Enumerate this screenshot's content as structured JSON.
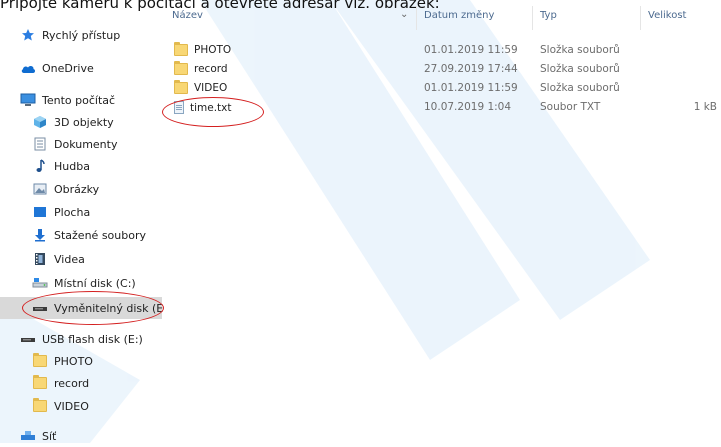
{
  "caption": "Připojte kameru k počítači a otevřete adresář viz. obrázek:",
  "nav": {
    "items": [
      {
        "label": "Rychlý přístup",
        "icon": "star-icon"
      },
      {
        "label": "OneDrive",
        "icon": "cloud-icon"
      },
      {
        "label": "Tento počítač",
        "icon": "computer-icon"
      },
      {
        "label": "3D objekty",
        "icon": "cube-icon"
      },
      {
        "label": "Dokumenty",
        "icon": "document-icon"
      },
      {
        "label": "Hudba",
        "icon": "music-note-icon"
      },
      {
        "label": "Obrázky",
        "icon": "pictures-icon"
      },
      {
        "label": "Plocha",
        "icon": "desktop-icon"
      },
      {
        "label": "Stažené soubory",
        "icon": "download-arrow-icon"
      },
      {
        "label": "Videa",
        "icon": "film-icon"
      },
      {
        "label": "Místní disk (C:)",
        "icon": "local-disk-icon"
      },
      {
        "label": "Vyměnitelný disk (E",
        "icon": "removable-drive-icon"
      },
      {
        "label": "USB flash disk (E:)",
        "icon": "usb-drive-icon"
      },
      {
        "label": "PHOTO",
        "icon": "folder-icon"
      },
      {
        "label": "record",
        "icon": "folder-icon"
      },
      {
        "label": "VIDEO",
        "icon": "folder-icon"
      },
      {
        "label": "Síť",
        "icon": "network-icon"
      }
    ]
  },
  "columns": {
    "name": "Název",
    "date": "Datum změny",
    "type": "Typ",
    "size": "Velikost"
  },
  "files": [
    {
      "name": "PHOTO",
      "date": "01.01.2019 11:59",
      "type": "Složka souborů",
      "size": "",
      "icon": "folder-icon"
    },
    {
      "name": "record",
      "date": "27.09.2019 17:44",
      "type": "Složka souborů",
      "size": "",
      "icon": "folder-icon"
    },
    {
      "name": "VIDEO",
      "date": "01.01.2019 11:59",
      "type": "Složka souborů",
      "size": "",
      "icon": "folder-icon"
    },
    {
      "name": "time.txt",
      "date": "10.07.2019 1:04",
      "type": "Soubor TXT",
      "size": "1 kB",
      "icon": "text-file-icon"
    }
  ],
  "colors": {
    "accent": "#0078d7",
    "annotation": "#d42020",
    "selection": "#d9d9d9",
    "header_text": "#4c6a8f"
  }
}
